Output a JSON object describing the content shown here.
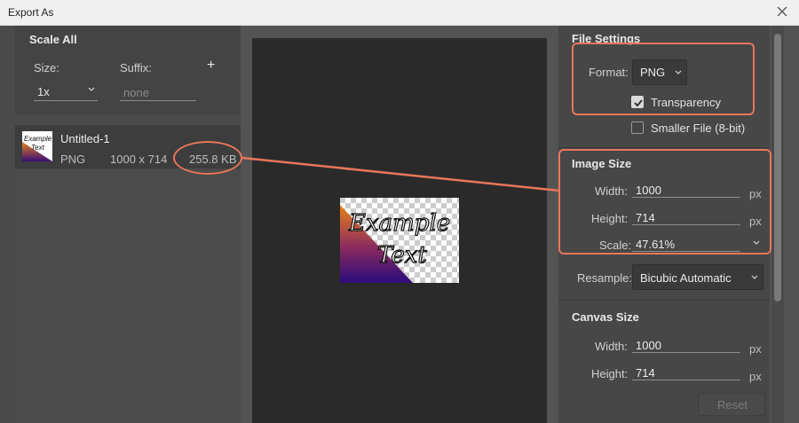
{
  "window": {
    "title": "Export As"
  },
  "scale_all": {
    "heading": "Scale All",
    "size_label": "Size:",
    "size_value": "1x",
    "suffix_label": "Suffix:",
    "suffix_placeholder": "none",
    "add_label": "+"
  },
  "asset": {
    "name": "Untitled-1",
    "format": "PNG",
    "dimensions": "1000 x 714",
    "file_size": "255.8 KB",
    "thumbnail_text_1": "Example",
    "thumbnail_text_2": "Text"
  },
  "preview": {
    "line1": "Example",
    "line2": "Text"
  },
  "file_settings": {
    "heading": "File Settings",
    "format_label": "Format:",
    "format_value": "PNG",
    "transparency_label": "Transparency",
    "transparency_checked": true,
    "smaller_file_label": "Smaller File (8-bit)",
    "smaller_file_checked": false
  },
  "image_size": {
    "heading": "Image Size",
    "width_label": "Width:",
    "width_value": "1000",
    "height_label": "Height:",
    "height_value": "714",
    "scale_label": "Scale:",
    "scale_value": "47.61%",
    "unit": "px",
    "resample_label": "Resample:",
    "resample_value": "Bicubic Automatic"
  },
  "canvas_size": {
    "heading": "Canvas Size",
    "width_label": "Width:",
    "width_value": "1000",
    "height_label": "Height:",
    "height_value": "714",
    "unit": "px",
    "reset_label": "Reset"
  },
  "colors": {
    "annotation": "#e8765b",
    "panel": "#444444",
    "background": "#535353",
    "preview_bg": "#2a2a2a"
  }
}
